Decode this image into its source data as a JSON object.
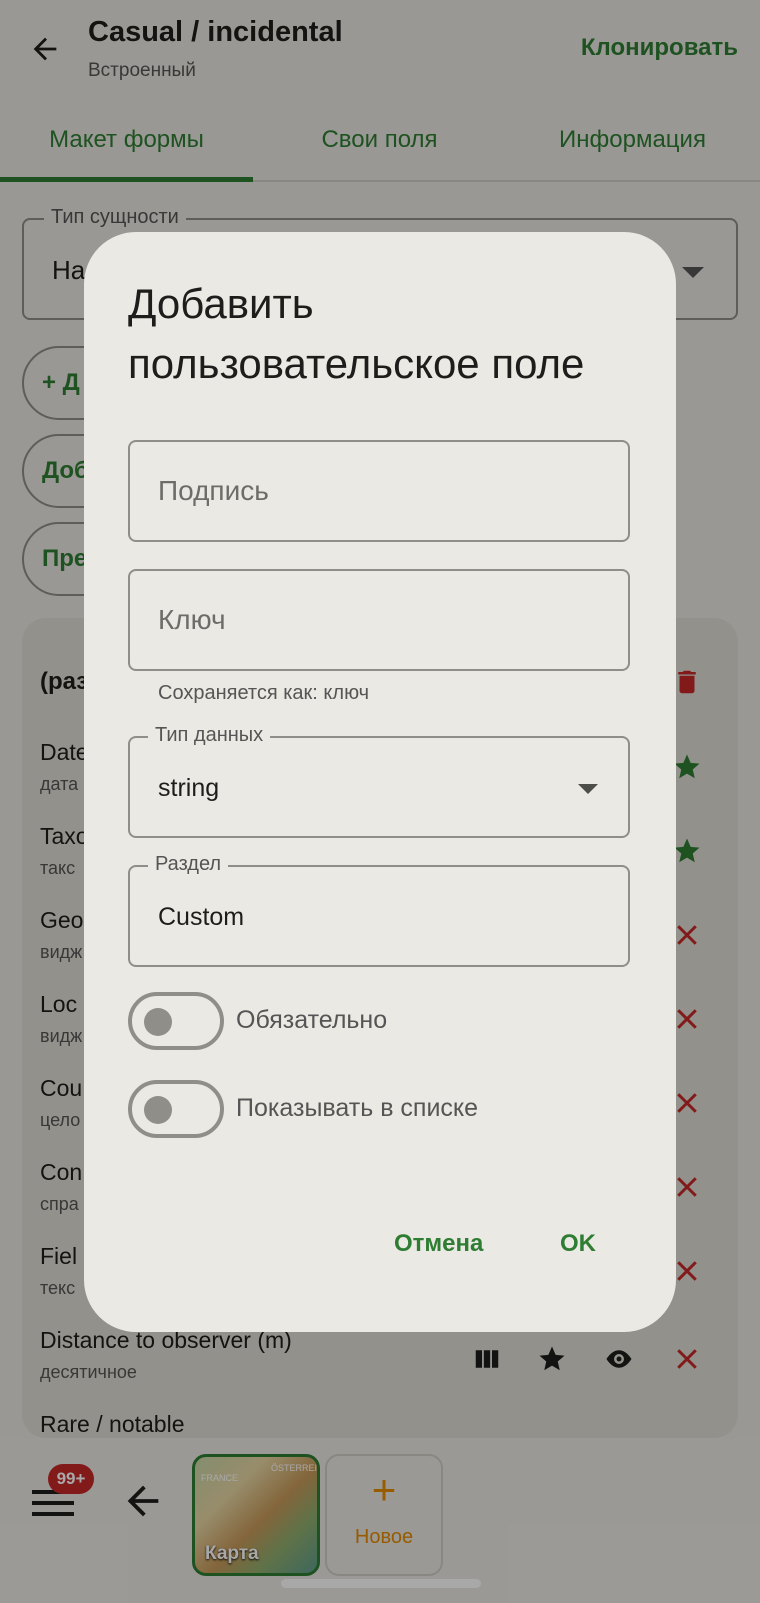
{
  "header": {
    "title": "Casual / incidental",
    "subtitle": "Встроенный",
    "clone_label": "Клонировать"
  },
  "tabs": [
    {
      "label": "Макет формы",
      "active": true
    },
    {
      "label": "Свои поля",
      "active": false
    },
    {
      "label": "Информация",
      "active": false
    }
  ],
  "entity": {
    "legend": "Тип сущности",
    "value": "На"
  },
  "pills": [
    {
      "label": "+ Д"
    },
    {
      "label": "Доб"
    },
    {
      "label": "Пре"
    }
  ],
  "section": {
    "header": "(раз"
  },
  "field_rows": [
    {
      "label": "Date",
      "type": "дата"
    },
    {
      "label": "Taxo",
      "type": "такс"
    },
    {
      "label": "Geo",
      "type": "видж"
    },
    {
      "label": "Loc",
      "type": "видж"
    },
    {
      "label": "Cou",
      "type": "цело"
    },
    {
      "label": "Con",
      "type": "спра"
    },
    {
      "label": "Fiel",
      "type": "текс"
    },
    {
      "label": "Distance to observer (m)",
      "type": "десятичное"
    },
    {
      "label": "Rare / notable",
      "type": ""
    }
  ],
  "bottom": {
    "badge": "99+",
    "map_label": "Карта",
    "map_small_1": "FRANCE",
    "map_small_2": "ÖSTERREICH",
    "new_label": "Новое",
    "new_plus": "+"
  },
  "dialog": {
    "title": "Добавить пользовательское поле",
    "caption_placeholder": "Подпись",
    "key_placeholder": "Ключ",
    "key_helper": "Сохраняется как: ключ",
    "datatype_legend": "Тип данных",
    "datatype_value": "string",
    "section_legend": "Раздел",
    "section_value": "Custom",
    "required_label": "Обязательно",
    "required_on": false,
    "show_in_list_label": "Показывать в списке",
    "show_in_list_on": false,
    "cancel_label": "Отмена",
    "ok_label": "OK"
  },
  "colors": {
    "accent": "#2e7d32",
    "danger": "#c62828",
    "orange": "#e58a00"
  }
}
